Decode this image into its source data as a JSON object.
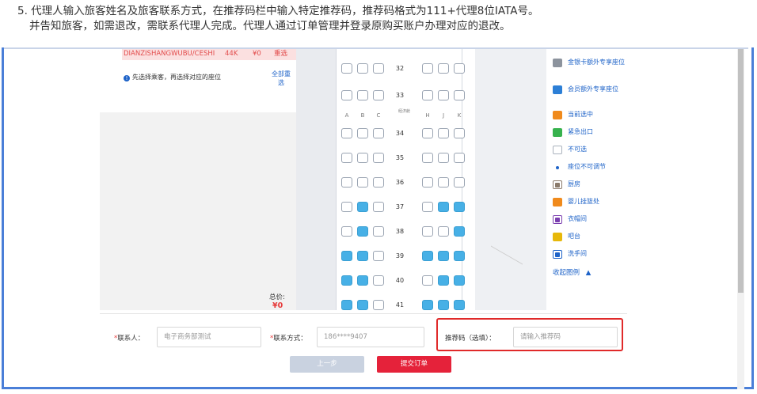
{
  "instruction": {
    "line1": "5. 代理人输入旅客姓名及旅客联系方式，在推荐码栏中输入特定推荐码，推荐码格式为111+代理8位IATA号。",
    "line2": "并告知旅客，如需退改，需联系代理人完成。代理人通过订单管理并登录原购买账户办理对应的退改。"
  },
  "passenger": {
    "name": "DIANZISHANGWUBU/CESHI",
    "seat": "44K",
    "price": "¥0",
    "reselect": "重选",
    "hint": "先选择乘客，再选择对应的座位",
    "reselect_all": "全部重选"
  },
  "total": {
    "label": "总价:",
    "value": "¥0"
  },
  "cabin": {
    "col_headers": [
      "A",
      "B",
      "C",
      "H",
      "J",
      "K"
    ],
    "section_label": "经济舱",
    "rows": [
      {
        "no": "32",
        "taken": [
          false,
          false,
          false,
          false,
          false,
          false
        ]
      },
      {
        "no": "33",
        "taken": [
          false,
          false,
          false,
          false,
          false,
          false
        ]
      },
      {
        "no": "34",
        "taken": [
          false,
          false,
          false,
          false,
          false,
          false
        ]
      },
      {
        "no": "35",
        "taken": [
          false,
          false,
          false,
          false,
          false,
          false
        ]
      },
      {
        "no": "36",
        "taken": [
          false,
          false,
          false,
          false,
          false,
          false
        ]
      },
      {
        "no": "37",
        "taken": [
          false,
          true,
          false,
          false,
          true,
          true
        ]
      },
      {
        "no": "38",
        "taken": [
          false,
          true,
          false,
          false,
          false,
          true
        ]
      },
      {
        "no": "39",
        "taken": [
          true,
          true,
          false,
          true,
          true,
          true
        ]
      },
      {
        "no": "40",
        "taken": [
          true,
          true,
          false,
          false,
          true,
          true
        ]
      },
      {
        "no": "41",
        "taken": [
          true,
          true,
          false,
          true,
          true,
          true
        ]
      }
    ]
  },
  "legend": {
    "items": [
      {
        "label": "金银卡额外专享座位",
        "icon": "seat-grey-icon",
        "color": "#8c939d"
      },
      {
        "label": "会员额外专享座位",
        "icon": "seat-blue-icon",
        "color": "#2c7fd6"
      },
      {
        "label": "当前选中",
        "icon": "seat-orange-icon",
        "color": "#f08a1c"
      },
      {
        "label": "紧急出口",
        "icon": "seat-green-icon",
        "color": "#37b24d"
      },
      {
        "label": "不可选",
        "icon": "seat-empty-icon",
        "color": "#ffffff"
      },
      {
        "label": "座位不可调节",
        "icon": "dot-icon",
        "color": "#1e63c8"
      },
      {
        "label": "厨房",
        "icon": "kitchen-icon",
        "color": "#8a7a6a"
      },
      {
        "label": "婴儿挂篮处",
        "icon": "baby-icon",
        "color": "#f08a1c"
      },
      {
        "label": "衣帽间",
        "icon": "coat-icon",
        "color": "#7b3fb0"
      },
      {
        "label": "吧台",
        "icon": "bar-icon",
        "color": "#e7b80a"
      },
      {
        "label": "洗手间",
        "icon": "toilet-icon",
        "color": "#1e63c8"
      }
    ],
    "collapse": "收起图例"
  },
  "form": {
    "contact_label": "联系人：",
    "contact_value": "电子商务部测试",
    "phone_label": "联系方式：",
    "phone_value": "186****9407",
    "promo_label": "推荐码（选填）：",
    "promo_placeholder": "请输入推荐码",
    "prev_btn": "上一步",
    "submit_btn": "提交订单"
  }
}
